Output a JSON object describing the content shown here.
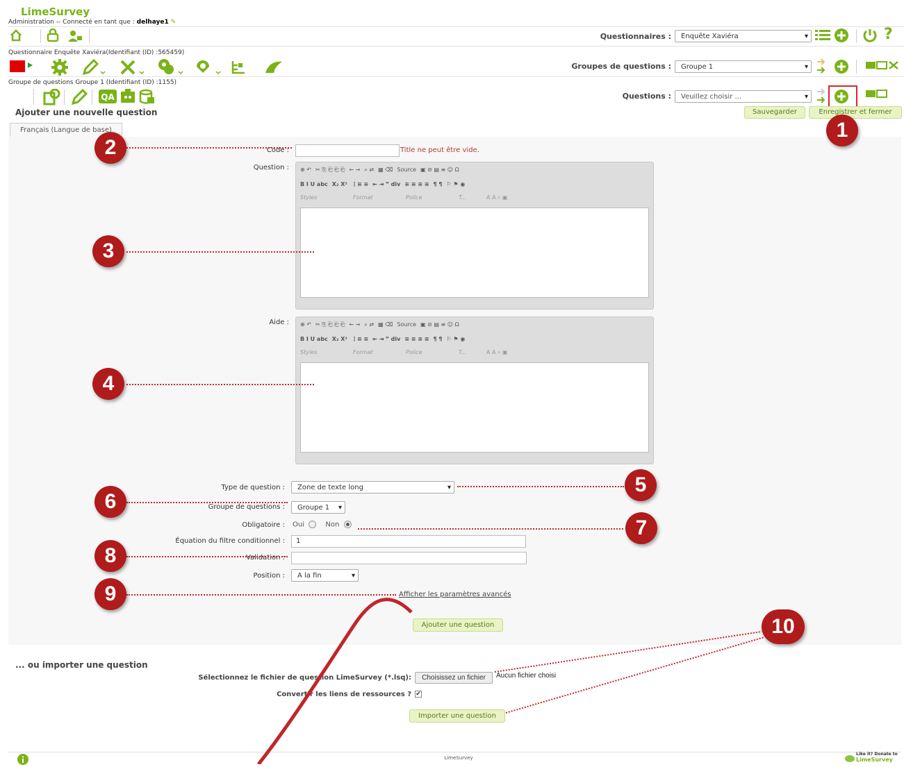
{
  "app": {
    "name": "LimeSurvey"
  },
  "header": {
    "admin_line": "Administration -- Connecté en tant que :",
    "username": "delhaye1"
  },
  "row1": {
    "surveys_label": "Questionnaires :",
    "survey_selected": "Enquête Xaviéra"
  },
  "row2": {
    "survey_info": "Questionnaire Enquête Xaviéra(Identifiant (ID) :565459)",
    "groups_label": "Groupes de questions :",
    "group_selected": "Groupe 1"
  },
  "row3": {
    "group_info": "Groupe de questions  Groupe 1 (Identifiant (ID) :1155)",
    "questions_label": "Questions :",
    "question_placeholder": "Veuillez choisir ..."
  },
  "page": {
    "title": "Ajouter une nouvelle question",
    "save_label": "Sauvegarder",
    "save_close_label": "Enregistrer et fermer",
    "tab_label": "Français (Langue de base)"
  },
  "form": {
    "code_label": "Code :",
    "code_error": "Title ne peut être vide.",
    "question_label": "Question :",
    "help_label": "Aide :",
    "type_label": "Type de question :",
    "type_value": "Zone de texte long",
    "group_label": "Groupe de questions :",
    "group_value": "Groupe 1",
    "mandatory_label": "Obligatoire :",
    "yes_label": "Oui",
    "no_label": "Non",
    "filter_label": "Équation du filtre conditionnel :",
    "filter_value": "1",
    "validation_label": "Validation :",
    "position_label": "Position :",
    "position_value": "A la fin",
    "advanced_link": "Afficher les paramètres avancés",
    "add_button": "Ajouter une question"
  },
  "editor": {
    "source": "Source",
    "styles": "Styles",
    "format": "Format",
    "police": "Police",
    "size": "T..."
  },
  "import": {
    "heading": "... ou importer une question",
    "file_label": "Sélectionnez le fichier de question LimeSurvey (*.lsq):",
    "file_button": "Choisissez un fichier",
    "file_status": "Aucun fichier choisi",
    "convert_label": "Convertir les liens de ressources ?",
    "import_button": "Importer une question"
  },
  "footer": {
    "center": "LimeSurvey",
    "donate_line1": "Like it? Donate to",
    "donate_line2": "LimeSurvey"
  },
  "markers": [
    "1",
    "2",
    "3",
    "4",
    "5",
    "6",
    "7",
    "8",
    "9",
    "10"
  ],
  "colors": {
    "brand": "#7ab317",
    "marker": "#b01b1b",
    "highlight": "#d9262a"
  }
}
